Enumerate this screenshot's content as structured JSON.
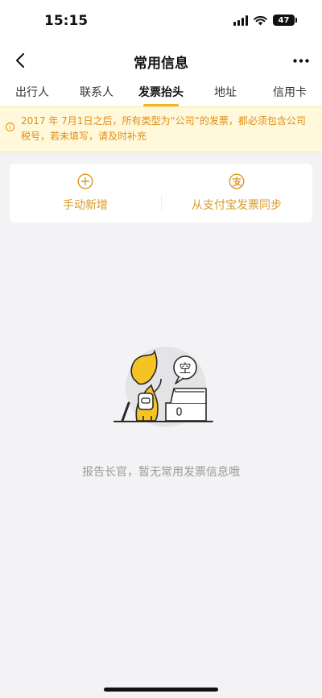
{
  "status_bar": {
    "time": "15:15",
    "battery": "47"
  },
  "header": {
    "title": "常用信息"
  },
  "tabs": [
    {
      "label": "出行人",
      "active": false
    },
    {
      "label": "联系人",
      "active": false
    },
    {
      "label": "发票抬头",
      "active": true
    },
    {
      "label": "地址",
      "active": false
    },
    {
      "label": "信用卡",
      "active": false
    }
  ],
  "notice": {
    "text": "2017 年 7月1日之后，所有类型为“公司”的发票，都必须包含公司税号，若未填写，请及时补充"
  },
  "actions": {
    "manual_add": "手动新增",
    "alipay_sync": "从支付宝发票同步"
  },
  "empty": {
    "bubble": "空",
    "message": "报告长官，暂无常用发票信息哦"
  },
  "colors": {
    "accent": "#f7b31b",
    "notice_text": "#e08e16",
    "action_text": "#d99a22"
  }
}
